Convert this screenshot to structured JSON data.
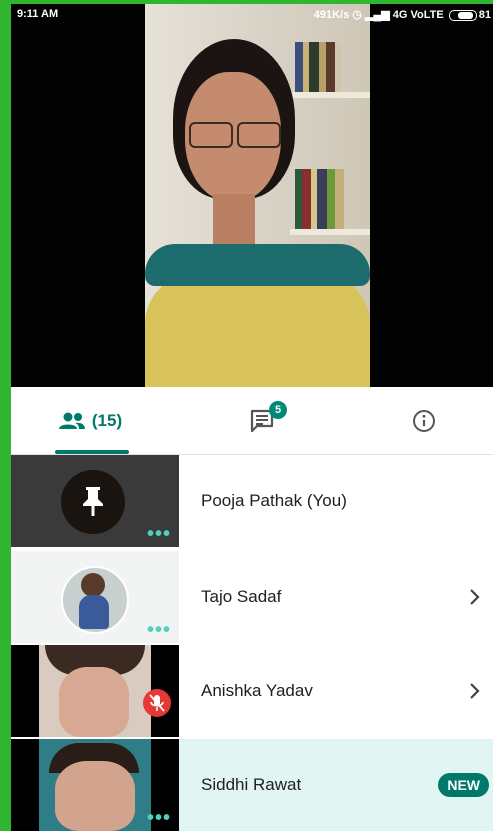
{
  "status_bar": {
    "time": "9:11 AM",
    "right_text": "491K/s",
    "network": "4G VoLTE",
    "battery": "81"
  },
  "tabs": {
    "people_count": "(15)",
    "chat_badge": "5"
  },
  "participants": [
    {
      "name": "Pooja Pathak (You)",
      "has_chevron": false,
      "new": false
    },
    {
      "name": "Tajo Sadaf",
      "has_chevron": true,
      "new": false
    },
    {
      "name": "Anishka Yadav",
      "has_chevron": true,
      "new": false
    },
    {
      "name": "Siddhi Rawat",
      "has_chevron": false,
      "new": true,
      "badge": "NEW"
    }
  ],
  "colors": {
    "accent": "#00796b",
    "frame": "#2fb52f",
    "highlight_row": "#e1f5f2",
    "mute": "#e53935"
  }
}
